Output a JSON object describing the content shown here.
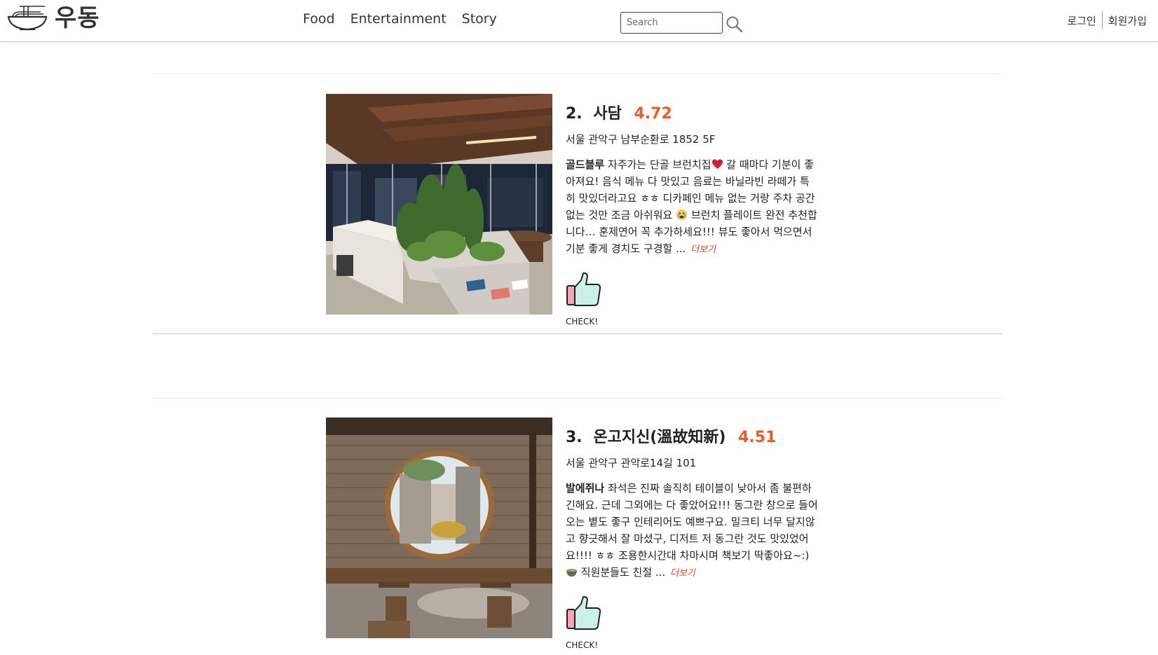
{
  "header": {
    "logo_text": "우동",
    "nav": [
      {
        "label": "Food"
      },
      {
        "label": "Entertainment"
      },
      {
        "label": "Story"
      }
    ],
    "search": {
      "placeholder": "Search",
      "value": ""
    },
    "login_label": "로그인",
    "signup_label": "회원가입"
  },
  "colors": {
    "rating": "#f05a28",
    "more_link": "#e8401c"
  },
  "posts": [
    {
      "rank": "2.",
      "name": "사담",
      "rating": "4.72",
      "address": "서울 관악구 남부순환로 1852 5F",
      "review_author": "골드블루",
      "review_part1": " 자주가는 단골 브런치집",
      "review_emoji1": "red-heart-emoji",
      "review_part2": " 갈 때마다 기분이 좋아져요! 음식 메뉴 다 맛있고 음료는 바닐라빈 라떼가 특히 맛있더라고요 ㅎㅎ 디카페인 메뉴 없는 거랑 주차 공간 없는 것만 조금 아쉬워요 ",
      "review_emoji2": "crying-face-emoji",
      "review_part3": " 브런치 플레이트 완전 추천합니다… 훈제연어 꼭 추가하세요!!! 뷰도 좋아서 먹으면서 기분 좋게 경치도 구경할 ...",
      "more_label": "더보기",
      "like_label": "CHECK!",
      "photo": "cafe-interior-with-plants-photo"
    },
    {
      "rank": "3.",
      "name": "온고지신(溫故知新)",
      "rating": "4.51",
      "address": "서울 관악구 관악로14길 101",
      "review_author": "발에쥐나",
      "review_part1": " 좌석은 진짜 솔직히 테이블이 낮아서 좀 불편하긴해요. 근데 그외에는 다 좋았어요!!! 동그란 창으로 들어오는 볕도 좋구 인테리어도 예쁘구요. 밀크티 너무 달지않고 향긋해서 잘 마셨구, 디저트 저 동그란 것도 맛있었어요!!!! ㅎㅎ 조용한시간대 차마시며 책보기 딱좋아요~:) ",
      "review_emoji1": "matcha-bowl-emoji",
      "review_part2": " 직원분들도 친절 ...",
      "more_label": "더보기",
      "like_label": "CHECK!",
      "photo": "round-window-brick-cafe-photo"
    }
  ]
}
